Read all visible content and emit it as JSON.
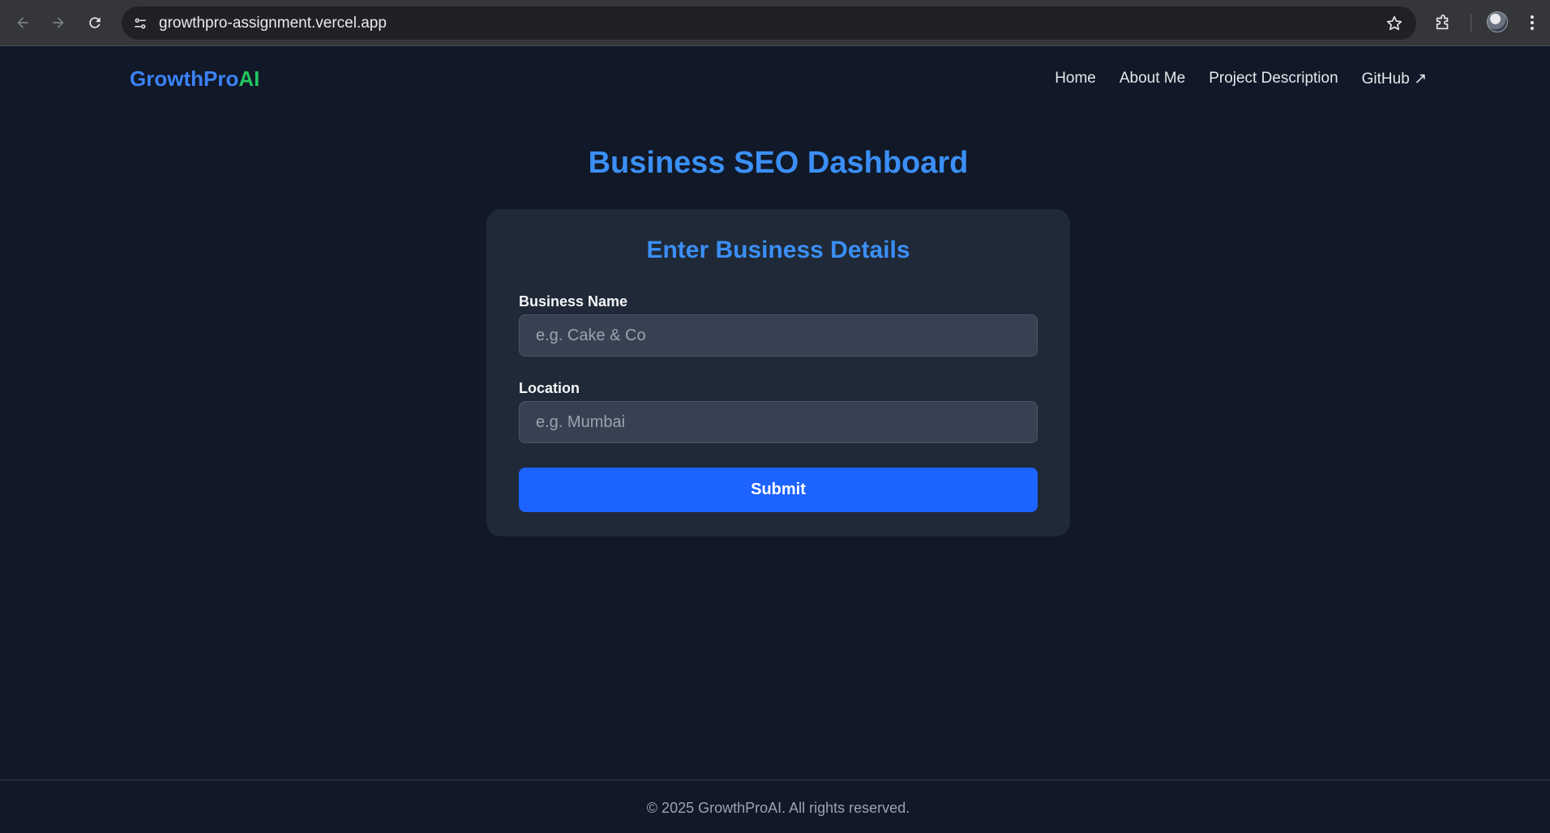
{
  "browser": {
    "url": "growthpro-assignment.vercel.app",
    "icons": {
      "back": "arrow-left-icon",
      "forward": "arrow-right-icon",
      "reload": "reload-icon",
      "site_info": "tune-icon",
      "bookmark": "star-icon",
      "extensions": "puzzle-icon",
      "profile": "avatar",
      "menu": "kebab-menu-icon"
    }
  },
  "header": {
    "logo_part1": "GrowthPro",
    "logo_part2": "AI",
    "nav": {
      "home": "Home",
      "about": "About Me",
      "project": "Project Description",
      "github": "GitHub ↗"
    }
  },
  "main": {
    "title": "Business SEO Dashboard",
    "form": {
      "title": "Enter Business Details",
      "business_name_label": "Business Name",
      "business_name_placeholder": "e.g. Cake & Co",
      "location_label": "Location",
      "location_placeholder": "e.g. Mumbai",
      "submit_label": "Submit"
    }
  },
  "footer": {
    "text": "© 2025 GrowthProAI. All rights reserved."
  },
  "colors": {
    "page_bg": "#111827",
    "card_bg": "#1f2937",
    "accent_blue": "#3b8ff6",
    "logo_green": "#22c55e",
    "button_blue": "#1d63ff"
  }
}
